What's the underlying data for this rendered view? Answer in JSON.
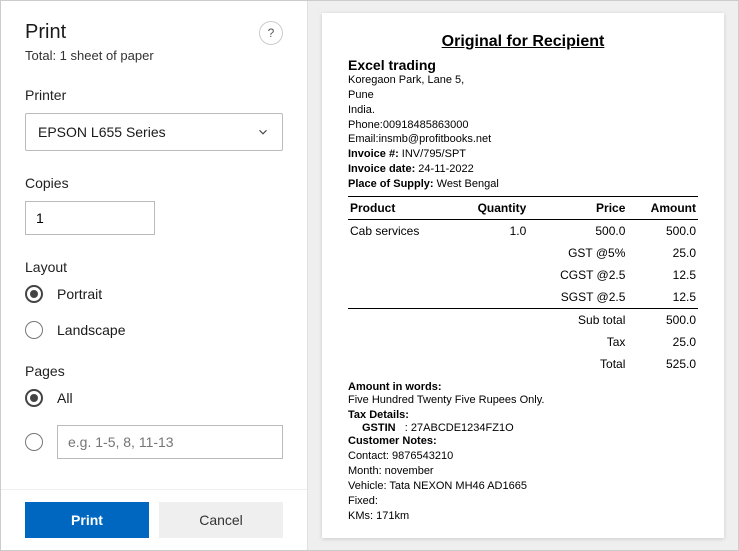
{
  "dialog": {
    "title": "Print",
    "total_line": "Total: 1 sheet of paper"
  },
  "sections": {
    "printer": {
      "label": "Printer",
      "selected": "EPSON L655 Series"
    },
    "copies": {
      "label": "Copies",
      "value": "1"
    },
    "layout": {
      "label": "Layout",
      "portrait": "Portrait",
      "landscape": "Landscape"
    },
    "pages": {
      "label": "Pages",
      "all": "All",
      "custom_placeholder": "e.g. 1-5, 8, 11-13"
    }
  },
  "buttons": {
    "print": "Print",
    "cancel": "Cancel"
  },
  "invoice": {
    "heading": "Original for Recipient",
    "company": "Excel trading",
    "addr1": "Koregaon Park, Lane 5,",
    "addr2": "Pune",
    "addr3": "India.",
    "phone_label": "Phone:",
    "phone": "00918485863000",
    "email_label": "Email:",
    "email": "insmb@profitbooks.net",
    "inv_no_label": "Invoice #:",
    "inv_no": " INV/795/SPT",
    "inv_date_label": "Invoice date:",
    "inv_date": " 24-11-2022",
    "pos_label": "Place of Supply:",
    "pos": " West Bengal",
    "cols": {
      "product": "Product",
      "qty": "Quantity",
      "price": "Price",
      "amount": "Amount"
    },
    "line": {
      "product": "Cab services",
      "qty": "1.0",
      "price": "500.0",
      "amount": "500.0"
    },
    "gst5_label": "GST @5%",
    "gst5": "25.0",
    "cgst_label": "CGST @2.5",
    "cgst": "12.5",
    "sgst_label": "SGST @2.5",
    "sgst": "12.5",
    "subtotal_label": "Sub total",
    "subtotal": "500.0",
    "tax_label": "Tax",
    "tax": "25.0",
    "total_label": "Total",
    "total": "525.0",
    "words_label": "Amount in words:",
    "words": "Five Hundred  Twenty Five Rupees Only.",
    "taxdet_label": "Tax Details:",
    "gstin_label": "GSTIN",
    "gstin": ": 27ABCDE1234FZ1O",
    "notes_label": "Customer Notes:",
    "contact": "Contact: 9876543210",
    "month": "Month: november",
    "vehicle": "Vehicle: Tata NEXON MH46 AD1665",
    "fixed": "Fixed:",
    "kms": "KMs: 171km"
  }
}
